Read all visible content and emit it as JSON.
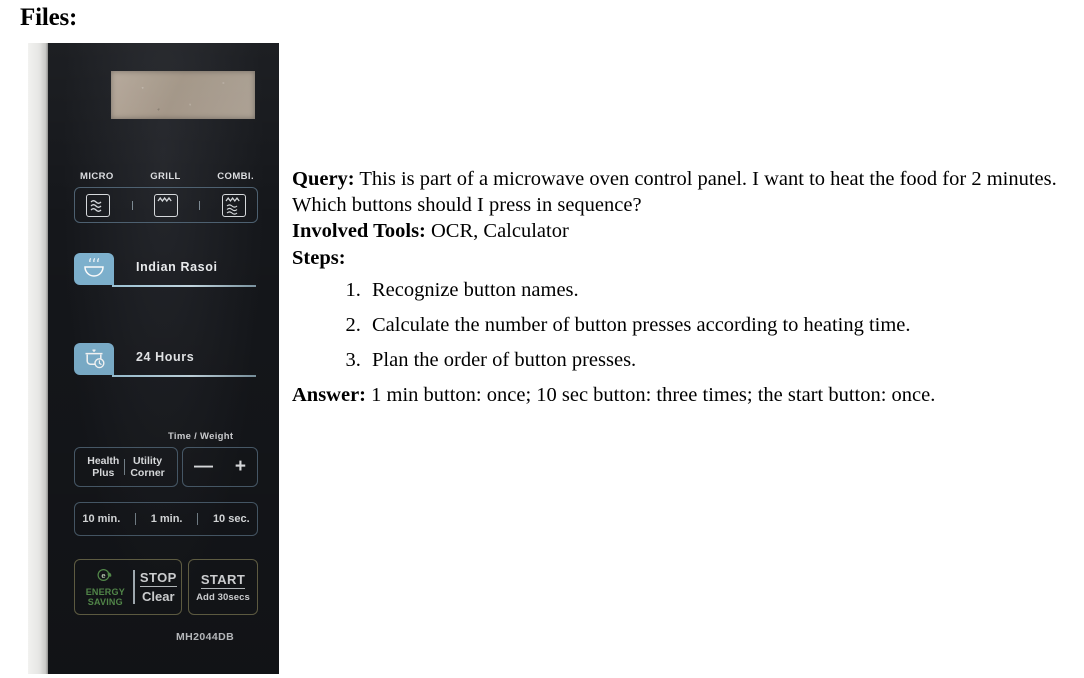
{
  "section_title": "Files:",
  "panel": {
    "display_label": "",
    "modes": [
      {
        "label": "MICRO",
        "icon": "microwave-waves-icon"
      },
      {
        "label": "GRILL",
        "icon": "grill-coil-icon"
      },
      {
        "label": "COMBI.",
        "icon": "combi-grill-waves-icon"
      }
    ],
    "menu_rows": [
      {
        "label": "Indian Rasoi",
        "icon": "steaming-bowl-icon"
      },
      {
        "label": "24 Hours",
        "icon": "pot-clock-icon"
      }
    ],
    "time_weight_label": "Time / Weight",
    "minus_label": "—",
    "plus_label": "+",
    "health_plus": "Health\nPlus",
    "health_plus_line1": "Health",
    "health_plus_line2": "Plus",
    "utility_corner_line1": "Utility",
    "utility_corner_line2": "Corner",
    "time_buttons": [
      "10 min.",
      "1 min.",
      "10 sec."
    ],
    "energy_saving_line1": "ENERGY",
    "energy_saving_line2": "SAVING",
    "energy_icon": "eco-leaf-icon",
    "stop_label": "STOP",
    "clear_label": "Clear",
    "start_label": "START",
    "add30_label": "Add 30secs",
    "model_number": "MH2044DB",
    "colors": {
      "panel_bg": "#15171b",
      "accent_blue": "#7fb3d0",
      "outline_blue": "#4d6070",
      "outline_gold": "#6d6a4c",
      "eco_green": "#5f9d55",
      "display_tan": "#a89c8e",
      "text_light": "#eceef0"
    }
  },
  "doc": {
    "query_label": "Query:",
    "query_text": " This is part of a microwave oven control panel. I want to heat the food for 2 minutes. Which buttons should I press in sequence?",
    "tools_label": "Involved Tools:",
    "tools_text": " OCR, Calculator",
    "steps_label": "Steps:",
    "steps": [
      "Recognize button names.",
      "Calculate the number of button presses according to heating time.",
      "Plan the order of button presses."
    ],
    "answer_label": "Answer:",
    "answer_text": " 1 min button: once; 10 sec button: three times; the start button: once."
  }
}
